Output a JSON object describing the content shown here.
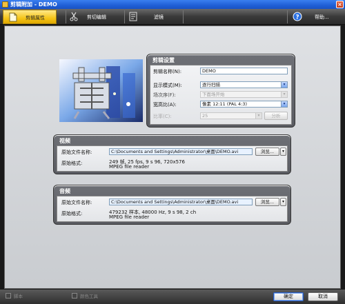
{
  "window": {
    "title": "剪辑附加 - DEMO",
    "close_symbol": "×"
  },
  "tabs": [
    {
      "label": "剪辑属性",
      "icon": "clip-properties-icon",
      "active": true
    },
    {
      "label": "剪切编辑",
      "icon": "scissors-icon",
      "active": false
    },
    {
      "label": "滤镜",
      "icon": "filter-icon",
      "active": false
    },
    {
      "label": "帮助...",
      "icon": "help-icon",
      "active": false
    }
  ],
  "clip_settings": {
    "header": "剪辑设置",
    "name_label": "剪辑名称(N):",
    "name_value": "DEMO",
    "display_mode_label": "显示模式(M):",
    "display_mode_value": "逐行扫描",
    "field_order_label": "场次序(F):",
    "field_order_value": "下面场开始",
    "aspect_label": "宽高比(A):",
    "aspect_value": "像素 12:11 (PAL 4:3)",
    "ratio_label": "比率(C):",
    "ratio_value": "25",
    "other_button": "分析"
  },
  "video": {
    "header": "视频",
    "source_label": "原始文件名称:",
    "source_value": "C:\\Documents and Settings\\Administrator\\桌面\\DEMO.avi",
    "browse_label": "浏览...",
    "format_label": "原始格式:",
    "format_line1": "249 帧, 25 fps, 9 s 96, 720x576",
    "format_line2": "MPEG file reader"
  },
  "audio": {
    "header": "音频",
    "source_label": "原始文件名称:",
    "source_value": "C:\\Documents and Settings\\Administrator\\桌面\\DEMO.avi",
    "browse_label": "浏览...",
    "format_label": "原始格式:",
    "format_line1": "479232 样本, 48000 Hz, 9 s 98, 2 ch",
    "format_line2": "MPEG file reader"
  },
  "bottom": {
    "check1": "脚本",
    "check2": "颜色工具",
    "ok": "确定",
    "cancel": "取消"
  },
  "colors": {
    "titlebar": "#1f5fd6",
    "active_tab": "#f5c518",
    "panel": "#5a5c62"
  }
}
